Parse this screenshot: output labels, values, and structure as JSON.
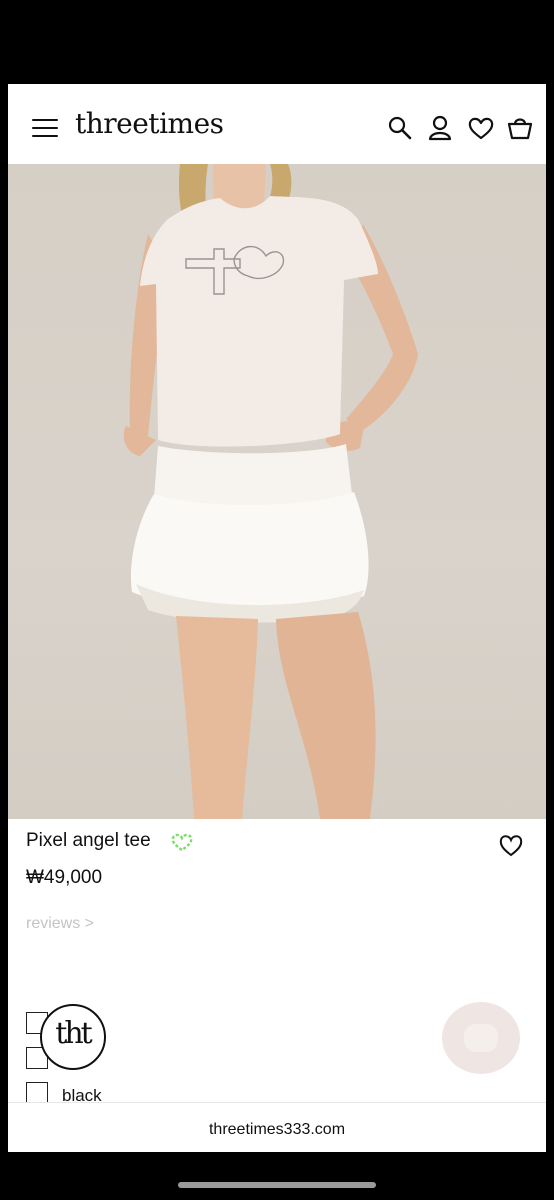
{
  "header": {
    "brand": "threetimes",
    "icons": [
      "menu-icon",
      "search-icon",
      "account-icon",
      "wishlist-icon",
      "cart-icon"
    ]
  },
  "gallery": {
    "image_alt": "Model wearing pixel angel tee with white ruffle skirt",
    "slide_count": 10,
    "active_slide": 10
  },
  "product": {
    "name": "Pixel angel tee",
    "price": "₩49,000",
    "reviews_link": "reviews >",
    "badge_color": "#7ddc6a"
  },
  "options": {
    "color_label": "black"
  },
  "footer": {
    "logo_text": "tht",
    "url": "threetimes333.com"
  }
}
